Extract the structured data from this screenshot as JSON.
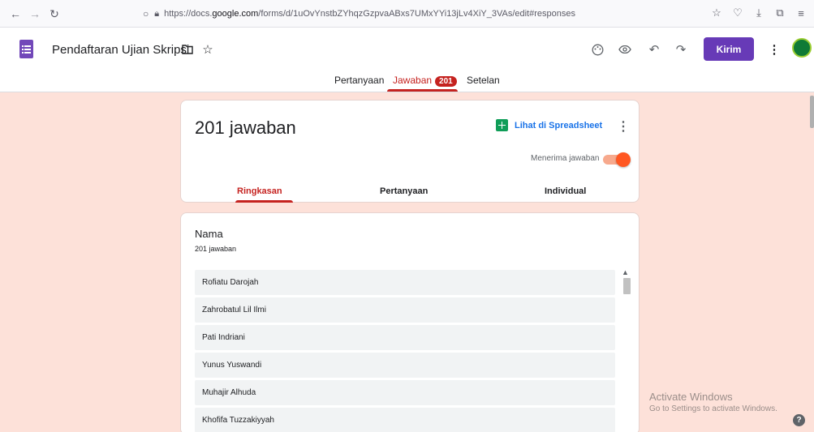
{
  "browser": {
    "url_prefix": "https://docs.",
    "url_host": "google.com",
    "url_path": "/forms/d/1uOvYnstbZYhqzGzpvaABxs7UMxYYi13jLv4XiY_3VAs/edit#responses"
  },
  "header": {
    "doc_title": "Pendaftaran Ujian Skripsi",
    "send_label": "Kirim"
  },
  "tabs": {
    "questions": "Pertanyaan",
    "responses": "Jawaban",
    "responses_badge": "201",
    "settings": "Setelan"
  },
  "summary": {
    "title": "201 jawaban",
    "sheet_link": "Lihat di Spreadsheet",
    "accepting_label": "Menerima jawaban",
    "accepting": true,
    "sub_tabs": [
      "Ringkasan",
      "Pertanyaan",
      "Individual"
    ]
  },
  "question": {
    "title": "Nama",
    "count": "201 jawaban",
    "answers": [
      "Rofiatu Darojah",
      "Zahrobatul Lil Ilmi",
      "Pati Indriani",
      "Yunus Yuswandi",
      "Muhajir Alhuda",
      "Khofifa Tuzzakiyyah"
    ]
  },
  "watermark": {
    "title": "Activate Windows",
    "subtitle": "Go to Settings to activate Windows."
  },
  "colors": {
    "accent": "#c5221f",
    "brand": "#673ab7",
    "background": "#fde1d9"
  }
}
